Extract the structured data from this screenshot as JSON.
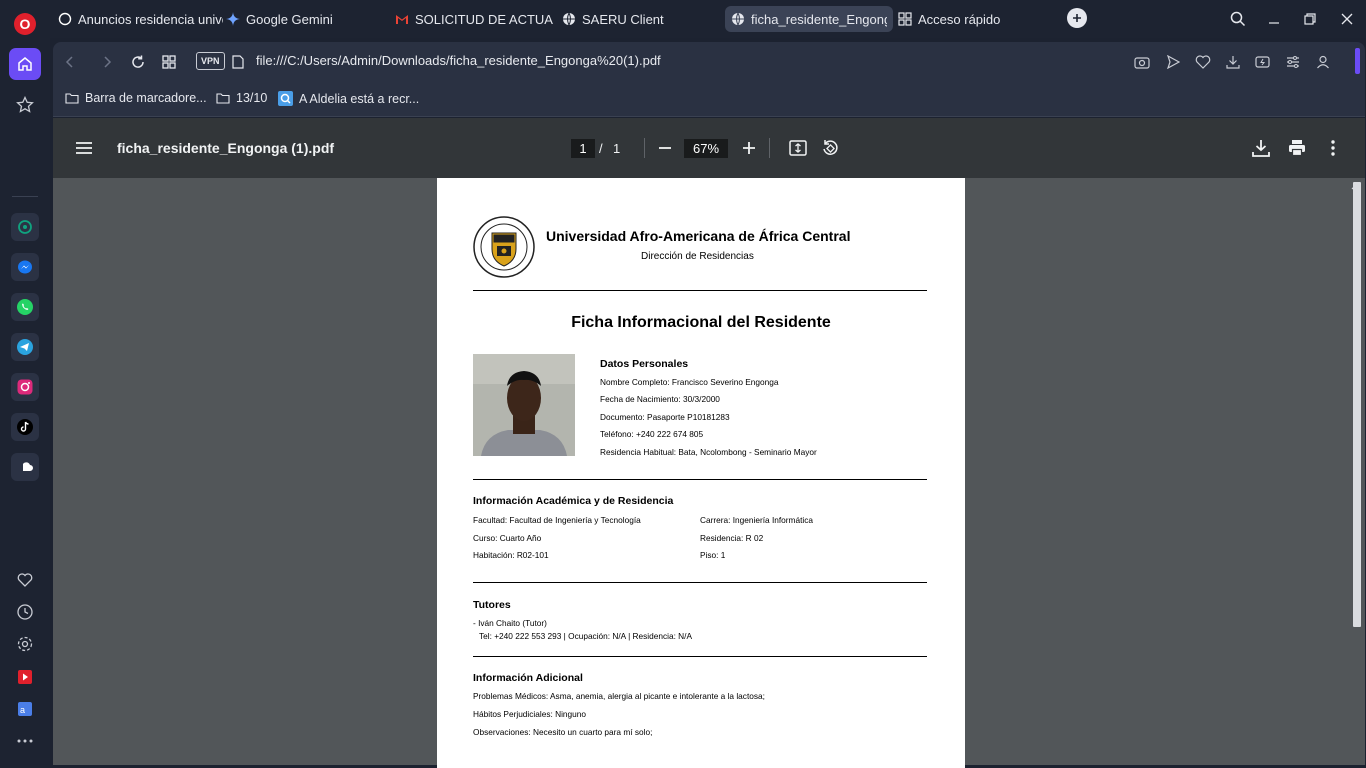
{
  "tabs": [
    {
      "label": "Anuncios residencia unive",
      "active": false
    },
    {
      "label": "Google Gemini",
      "active": false
    },
    {
      "label": "SOLICITUD DE ACTUALIZA",
      "active": false
    },
    {
      "label": "SAERU Client",
      "active": false
    },
    {
      "label": "ficha_residente_Engonga (",
      "active": true
    },
    {
      "label": "Acceso rápido",
      "active": false
    }
  ],
  "address": {
    "vpn_label": "VPN",
    "url": "file:///C:/Users/Admin/Downloads/ficha_residente_Engonga%20(1).pdf"
  },
  "bookmarks": [
    {
      "label": "Barra de marcadore..."
    },
    {
      "label": "13/10"
    },
    {
      "label": "A Aldelia está a recr..."
    }
  ],
  "pdf_viewer": {
    "filename": "ficha_residente_Engonga (1).pdf",
    "current_page": "1",
    "page_sep": "/",
    "total_pages": "1",
    "zoom": "67%"
  },
  "document": {
    "university": "Universidad Afro-Americana de África Central",
    "department": "Dirección de Residencias",
    "title": "Ficha Informacional del Residente",
    "personal": {
      "heading": "Datos Personales",
      "full_name": "Nombre Completo: Francisco Severino Engonga",
      "birth_date": "Fecha de Nacimiento: 30/3/2000",
      "document": "Documento: Pasaporte P10181283",
      "phone": "Teléfono: +240 222 674 805",
      "residence": "Residencia Habitual: Bata, Ncolombong - Seminario Mayor"
    },
    "academic": {
      "heading": "Información Académica y de Residencia",
      "faculty": "Facultad: Facultad de Ingeniería y Tecnología",
      "career": "Carrera: Ingeniería Informática",
      "course": "Curso: Cuarto Año",
      "residence": "Residencia: R 02",
      "room": "Habitación: R02-101",
      "floor": "Piso: 1"
    },
    "tutors": {
      "heading": "Tutores",
      "tutor1_name": "- Iván Chaito (Tutor)",
      "tutor1_details": "Tel: +240 222 553 293 | Ocupación: N/A | Residencia: N/A"
    },
    "additional": {
      "heading": "Información Adicional",
      "medical": "Problemas Médicos: Asma, anemia, alergia al picante e intolerante a la lactosa;",
      "habits": "Hábitos Perjudiciales: Ninguno",
      "notes": "Observaciones: Necesito un cuarto para mí solo;"
    }
  },
  "colors": {
    "opera_red": "#e0202c",
    "home_accent": "#6b4cf5",
    "pdf_toolbar": "#323639",
    "pdf_bg": "#525659"
  }
}
